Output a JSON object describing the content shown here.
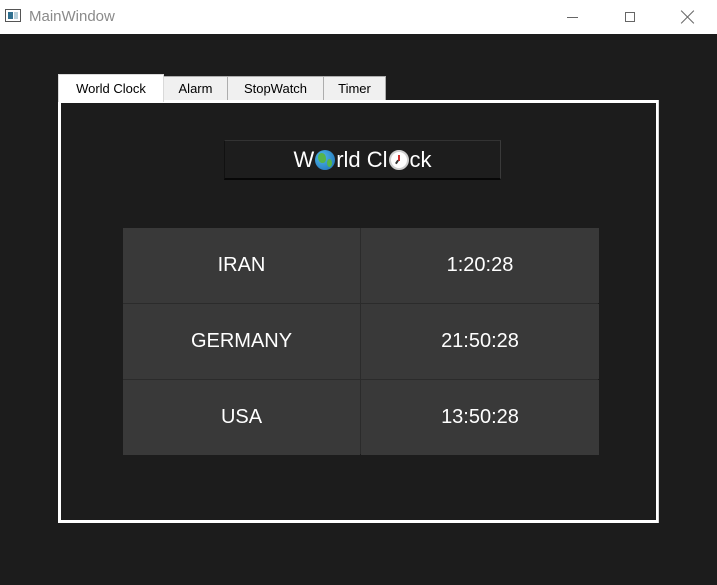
{
  "window": {
    "title": "MainWindow"
  },
  "tabs": [
    {
      "label": "World Clock",
      "active": true
    },
    {
      "label": "Alarm",
      "active": false
    },
    {
      "label": "StopWatch",
      "active": false
    },
    {
      "label": "Timer",
      "active": false
    }
  ],
  "heading": {
    "part1": "W",
    "part2": "rld Cl",
    "part3": "ck",
    "icons": [
      "globe-icon",
      "clock-icon"
    ]
  },
  "clocks": [
    {
      "country": "IRAN",
      "time": "1:20:28"
    },
    {
      "country": "GERMANY",
      "time": "21:50:28"
    },
    {
      "country": "USA",
      "time": "13:50:28"
    }
  ],
  "colors": {
    "background": "#1c1c1c",
    "panel_border": "#ffffff",
    "table_cell": "#393939",
    "text": "#ffffff"
  }
}
